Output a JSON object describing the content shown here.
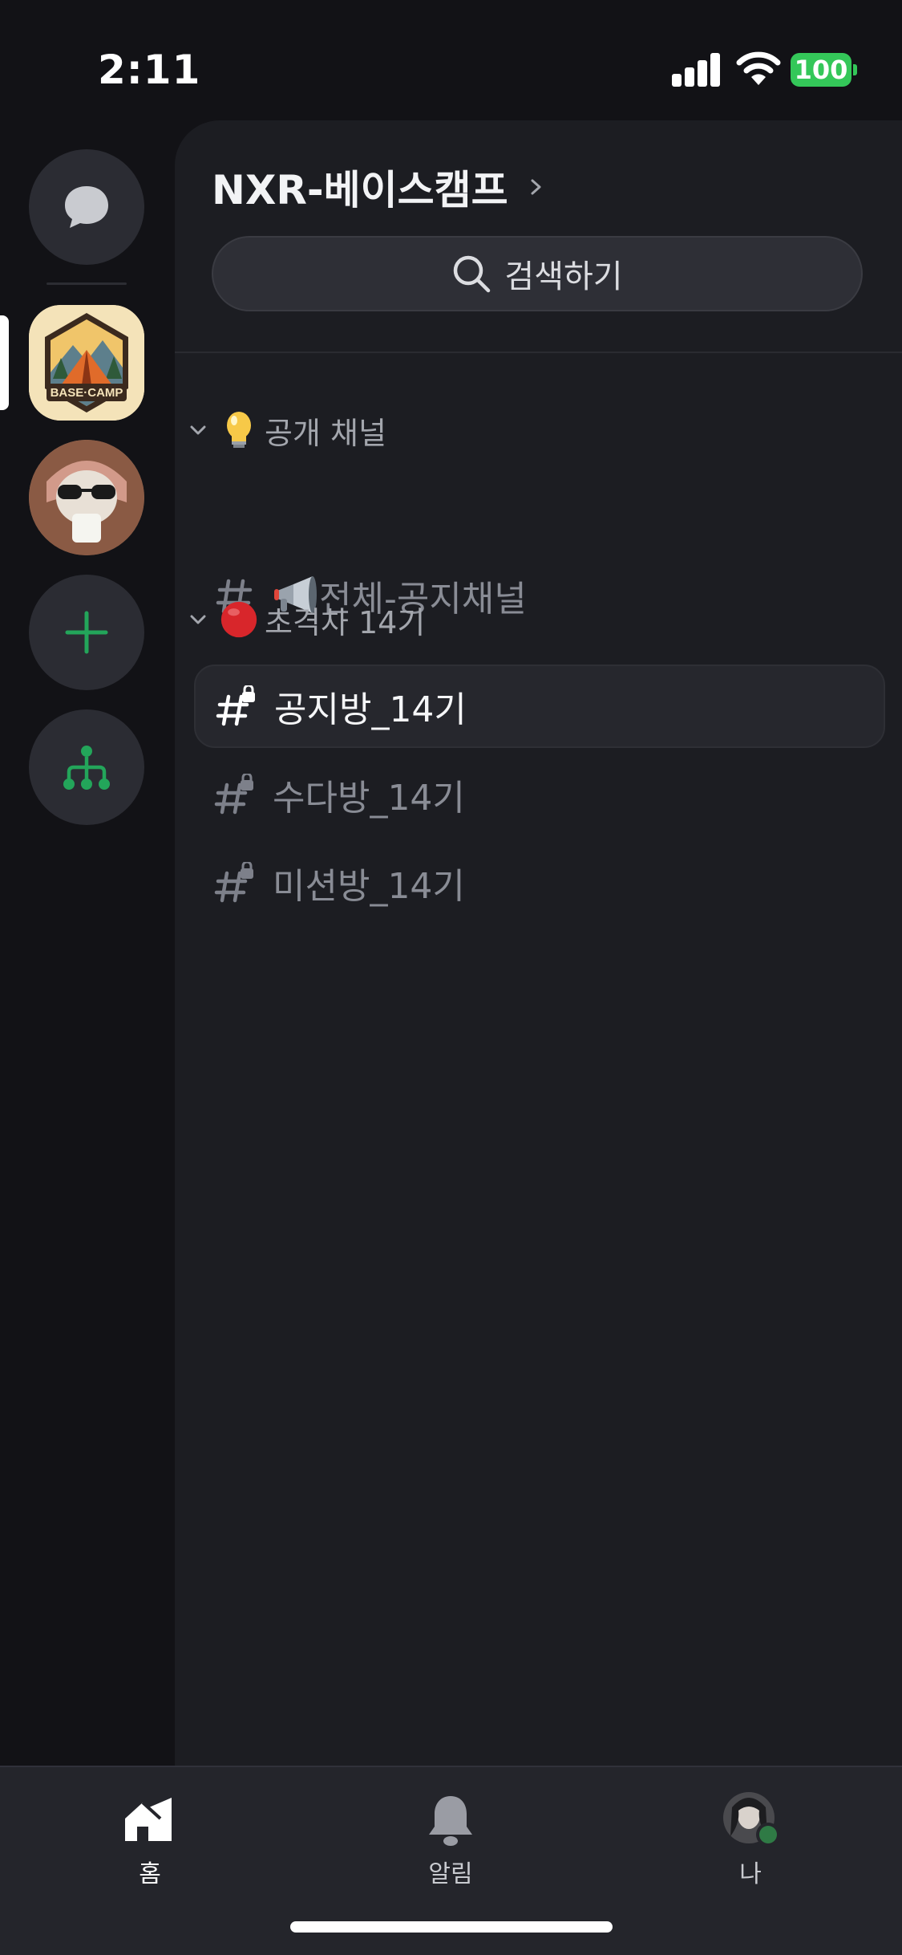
{
  "status_bar": {
    "time": "2:11",
    "battery": "100",
    "battery_color": "#34c759"
  },
  "server_rail": {
    "items": [
      {
        "name": "direct-messages",
        "icon": "chat-bubble-icon"
      },
      {
        "name": "BASE·CAMP",
        "icon": "basecamp-tent-logo",
        "selected": true
      },
      {
        "name": "server-avatar",
        "icon": "cat-sunglasses-avatar"
      },
      {
        "name": "add-server",
        "icon": "plus-icon",
        "color": "#23a55a"
      },
      {
        "name": "discover",
        "icon": "hub-tree-icon",
        "color": "#23a55a"
      }
    ],
    "basecamp_logo_text": "BASE·CAMP"
  },
  "server": {
    "name": "NXR-베이스캠프"
  },
  "search": {
    "label": "검색하기"
  },
  "categories": [
    {
      "emoji": "💡",
      "label": "공개 채널",
      "channels": [
        {
          "emoji": "📢",
          "label": "전체-공지채널",
          "locked": false,
          "selected": false
        }
      ]
    },
    {
      "emoji": "🔴",
      "label": "초격차 14기",
      "channels": [
        {
          "label": "공지방_14기",
          "locked": true,
          "selected": true
        },
        {
          "label": "수다방_14기",
          "locked": true,
          "selected": false
        },
        {
          "label": "미션방_14기",
          "locked": true,
          "selected": false
        }
      ]
    }
  ],
  "tab_bar": {
    "tabs": [
      {
        "label": "홈",
        "icon": "home-icon",
        "active": true
      },
      {
        "label": "알림",
        "icon": "bell-icon",
        "active": false
      },
      {
        "label": "나",
        "icon": "profile-avatar-icon",
        "active": false,
        "status_color": "#23a55a"
      }
    ]
  }
}
